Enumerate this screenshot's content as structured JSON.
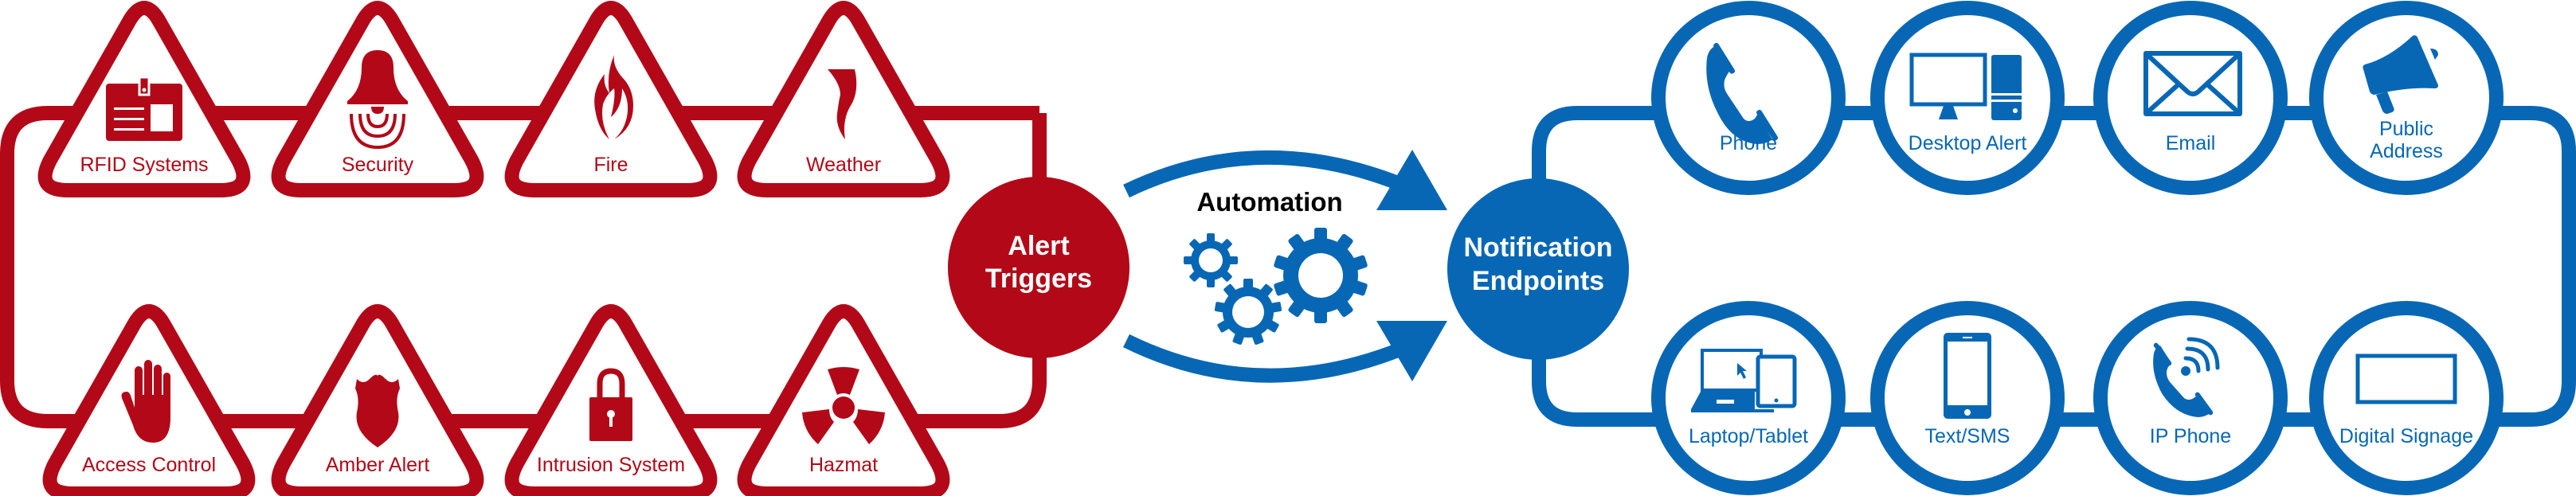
{
  "colors": {
    "trigger": "#B20818",
    "endpoint": "#0767B5",
    "automation_text": "#000000"
  },
  "alert_triggers": {
    "hub": {
      "lines": [
        "Alert",
        "Triggers"
      ]
    },
    "top": [
      {
        "label": "RFID Systems",
        "icon": "id-badge-icon"
      },
      {
        "label": "Security",
        "icon": "alarm-bell-icon"
      },
      {
        "label": "Fire",
        "icon": "flame-icon"
      },
      {
        "label": "Weather",
        "icon": "tornado-icon"
      }
    ],
    "bottom": [
      {
        "label": "Access Control",
        "icon": "hand-stop-icon"
      },
      {
        "label": "Amber Alert",
        "icon": "police-badge-icon"
      },
      {
        "label": "Intrusion System",
        "icon": "padlock-icon"
      },
      {
        "label": "Hazmat",
        "icon": "radiation-icon"
      }
    ]
  },
  "automation": {
    "label": "Automation",
    "icon": "gears-icon"
  },
  "notification_endpoints": {
    "hub": {
      "lines": [
        "Notification",
        "Endpoints"
      ]
    },
    "top": [
      {
        "label": "Phone",
        "icon": "phone-handset-icon"
      },
      {
        "label": "Desktop Alert",
        "icon": "desktop-computer-icon"
      },
      {
        "label": "Email",
        "icon": "envelope-icon"
      },
      {
        "label": "Public Address",
        "label_lines": [
          "Public",
          "Address"
        ],
        "icon": "megaphone-icon"
      }
    ],
    "bottom": [
      {
        "label": "Laptop/Tablet",
        "icon": "laptop-tablet-icon"
      },
      {
        "label": "Text/SMS",
        "icon": "smartphone-icon"
      },
      {
        "label": "IP Phone",
        "icon": "ip-phone-icon"
      },
      {
        "label": "Digital Signage",
        "icon": "display-screen-icon"
      }
    ]
  }
}
